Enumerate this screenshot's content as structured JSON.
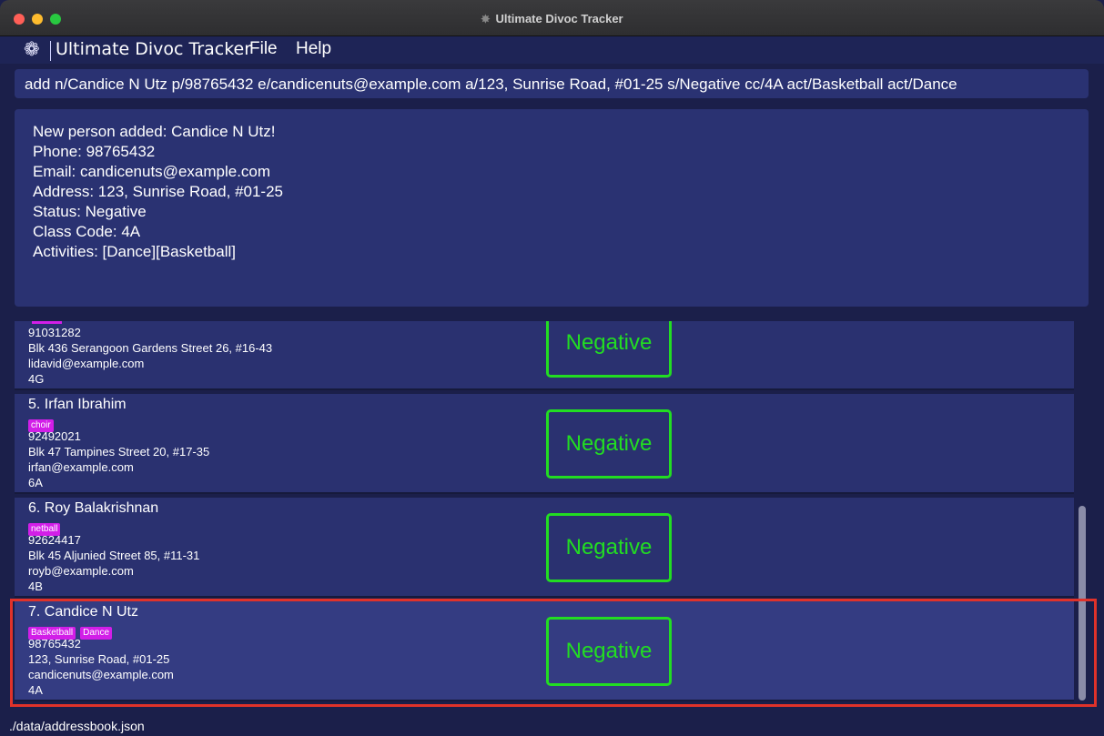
{
  "window": {
    "title": "Ultimate Divoc Tracker",
    "app_icon": "app-icon"
  },
  "menubar": {
    "logo_icon": "virus-logo-icon",
    "title": "Ultimate Divoc Tracker",
    "file": "File",
    "help": "Help"
  },
  "command": {
    "value": "add n/Candice N Utz p/98765432 e/candicenuts@example.com a/123, Sunrise Road, #01-25 s/Negative cc/4A act/Basketball act/Dance"
  },
  "result": {
    "lines": [
      "New person added: Candice N Utz!",
      "Phone: 98765432",
      "Email: candicenuts@example.com",
      "Address: 123, Sunrise Road, #01-25",
      "Status: Negative",
      "Class Code: 4A",
      "Activities: [Dance][Basketball]"
    ]
  },
  "persons": [
    {
      "phone": "91031282",
      "address": "Blk 436 Serangoon Gardens Street 26, #16-43",
      "email": "lidavid@example.com",
      "class_code": "4G",
      "status": "Negative"
    },
    {
      "name": "5.  Irfan Ibrahim",
      "tags": [
        "choir"
      ],
      "phone": "92492021",
      "address": "Blk 47 Tampines Street 20, #17-35",
      "email": "irfan@example.com",
      "class_code": "6A",
      "status": "Negative"
    },
    {
      "name": "6.  Roy Balakrishnan",
      "tags": [
        "netball"
      ],
      "phone": "92624417",
      "address": "Blk 45 Aljunied Street 85, #11-31",
      "email": "royb@example.com",
      "class_code": "4B",
      "status": "Negative"
    },
    {
      "name": "7.  Candice N Utz",
      "tags": [
        "Basketball",
        "Dance"
      ],
      "phone": "98765432",
      "address": "123, Sunrise Road, #01-25",
      "email": "candicenuts@example.com",
      "class_code": "4A",
      "status": "Negative"
    }
  ],
  "colors": {
    "status_negative": "#22dd22",
    "tag": "#d21ee8",
    "selection": "#e0322a"
  },
  "statusbar": {
    "path": "./data/addressbook.json"
  }
}
